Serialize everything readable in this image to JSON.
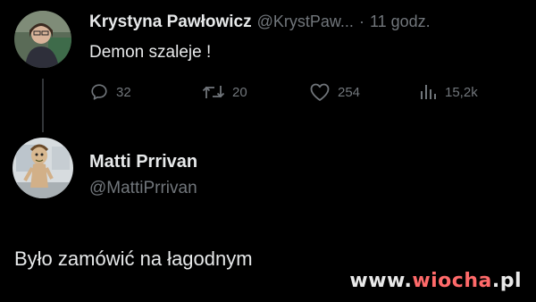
{
  "tweet": {
    "author_name": "Krystyna Pawłowicz",
    "author_handle": "@KrystPaw...",
    "time_separator": "·",
    "time": "11 godz.",
    "text": "Demon szaleje !",
    "stats": {
      "replies": "32",
      "retweets": "20",
      "likes": "254",
      "views": "15,2k"
    }
  },
  "reply": {
    "author_name": "Matti Prrivan",
    "author_handle": "@MattiPrrivan",
    "text": "Było zamówić na łagodnym"
  },
  "watermark": {
    "prefix": "www.",
    "brand": "wiocha",
    "suffix": ".pl"
  },
  "colors": {
    "background": "#000000",
    "primary_text": "#e7e9ea",
    "secondary_text": "#71767b",
    "thread_line": "#333639"
  }
}
